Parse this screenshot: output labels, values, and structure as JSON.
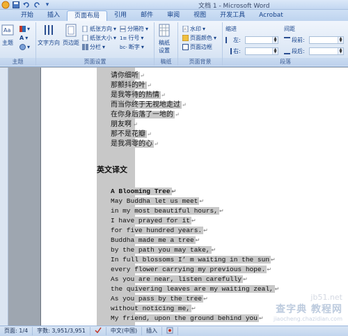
{
  "app": {
    "title": "文档 1 - Microsoft Word",
    "quick_access": [
      "save-icon",
      "undo-icon",
      "redo-icon",
      "dropdown-icon"
    ]
  },
  "tabs": [
    {
      "label": "开始"
    },
    {
      "label": "插入"
    },
    {
      "label": "页面布局",
      "active": true
    },
    {
      "label": "引用"
    },
    {
      "label": "邮件"
    },
    {
      "label": "审阅"
    },
    {
      "label": "视图"
    },
    {
      "label": "开发工具"
    },
    {
      "label": "Acrobat"
    }
  ],
  "ribbon": {
    "groups": {
      "theme": "主题",
      "page_setup": "页面设置",
      "manuscript": "稿纸",
      "page_background": "页面背景",
      "paragraph": "段落"
    },
    "theme_button": "主题",
    "text_direction": "文字方向",
    "margins": "页边距",
    "orientation": "纸张方向",
    "size": "纸张大小",
    "columns": "分栏",
    "breaks": "分隔符",
    "line_numbers": "行号",
    "hyphenation": "断字",
    "manuscript_settings_1": "稿纸",
    "manuscript_settings_2": "设置",
    "watermark": "水印",
    "page_color": "页面颜色",
    "page_borders": "页面边框",
    "indent_label": "缩进",
    "indent_left": "左:",
    "indent_right": "右:",
    "spacing_label": "间距",
    "spacing_before": "段前:",
    "spacing_after": "段后:"
  },
  "document": {
    "cn_lines": [
      "请你细听",
      "那颤抖的叶",
      "是我等待的热情",
      "而当你终于无视地走过",
      "在你身后落了一地的",
      "朋友啊",
      "那不是花瓣",
      "是我凋零的心"
    ],
    "heading": "英文译文",
    "en_title": "A Blooming Tree",
    "en_lines": [
      "May Buddha let us meet",
      "in my most beautiful hours,",
      "I have prayed for it",
      "for five hundred years.",
      "Buddha made me a tree",
      "by the path you may take,",
      "In full blossoms I’ m waiting in the sun",
      "every flower carrying my previous hope.",
      "As you are near, listen carefully",
      "the quivering leaves are my waiting zeal,",
      "As you pass by the tree",
      "without noticing me,",
      "My friend, upon the ground behind you"
    ],
    "para_mark": "↵"
  },
  "watermark": {
    "line1": "jb51.net",
    "line2": "查字典 教程网",
    "line3": "jiaocheng.chazidian.com"
  },
  "status": {
    "page": "页面: 1/4",
    "words": "字数: 3,951/3,951",
    "language": "中文(中国)",
    "insert": "插入"
  },
  "colors": {
    "accent": "#15428b",
    "ribbon_bg": "#dfe9f6",
    "selection": "#c8c8c8"
  }
}
